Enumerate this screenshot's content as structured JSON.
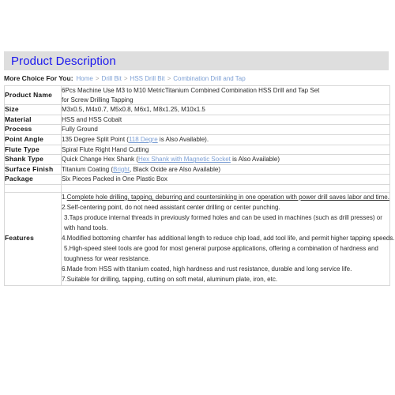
{
  "header": {
    "title": "Product Description",
    "bar_color": "#dedede",
    "title_color": "#1b17ee"
  },
  "breadcrumb": {
    "label": "More Choice For You:",
    "separator": ">",
    "link_color": "#7c9fd4",
    "items": [
      "Home",
      "Drill Bit",
      "HSS Drill Bit",
      "Combination Drill and Tap"
    ]
  },
  "spec_table": {
    "rows": [
      {
        "label": "Product Name",
        "value_line1": "6Pcs Machine Use M3 to M10 MetricTitanium Combined Combination HSS  Drill and Tap  Set",
        "value_line2": "for Screw Drilling Tapping"
      },
      {
        "label": "Size",
        "value_line1": "M3x0.5, M4x0.7, M5x0.8, M6x1, M8x1.25, M10x1.5"
      },
      {
        "label": "Material",
        "value_line1": "HSS and HSS Cobalt"
      },
      {
        "label": "Process",
        "value_line1": "Fully Ground"
      },
      {
        "label": "Point Angle",
        "value_prefix": "135 Degree Split Point (",
        "value_link": "118 Degre",
        "value_suffix": " is Also Available)."
      },
      {
        "label": "Flute Type",
        "value_line1": "Spiral Flute Right Hand Cutting"
      },
      {
        "label": "Shank Type",
        "value_prefix": "Quick Change Hex Shank (",
        "value_link": "Hex Shank with Magnetic Socket",
        "value_suffix": " is Also Available)"
      },
      {
        "label": "Surface Finish",
        "value_prefix": "Titanium Coating (",
        "value_link": "Bright",
        "value_suffix": ", Black Oxide are Also Available)"
      },
      {
        "label": "Package",
        "value_line1": "Six Pieces Packed in One Plastic Box"
      }
    ],
    "features": {
      "label": "Features",
      "lines": [
        {
          "number": "1.",
          "text": "Complete hole drilling, tapping, deburring and countersinking in one operation with power drill saves labor and time.",
          "underline": true
        },
        {
          "number": "2.",
          "text": "Self-centering point, do not need assistant center drilling or center punching.",
          "underline": false
        },
        {
          "number": "3.",
          "text": "Taps produce internal threads in previously formed holes and can be used in machines (such as drill presses) or with hand tools.",
          "underline": false
        },
        {
          "number": "4.",
          "text": "Modified bottoming chamfer has additional length to reduce chip load, add tool life, and permit higher tapping speeds.",
          "underline": false
        },
        {
          "number": "5.",
          "text": "High-speed steel tools are good for most general purpose applications, offering a combination of hardness and toughness for wear resistance.",
          "underline": false
        },
        {
          "number": "6.",
          "text": "Made from HSS with titanium coated, high hardness and rust resistance, durable and long service life.",
          "underline": false
        },
        {
          "number": "7.",
          "text": "Suitable for drilling, tapping, cutting on soft metal, aluminum plate, iron, etc.",
          "underline": false
        }
      ]
    }
  }
}
